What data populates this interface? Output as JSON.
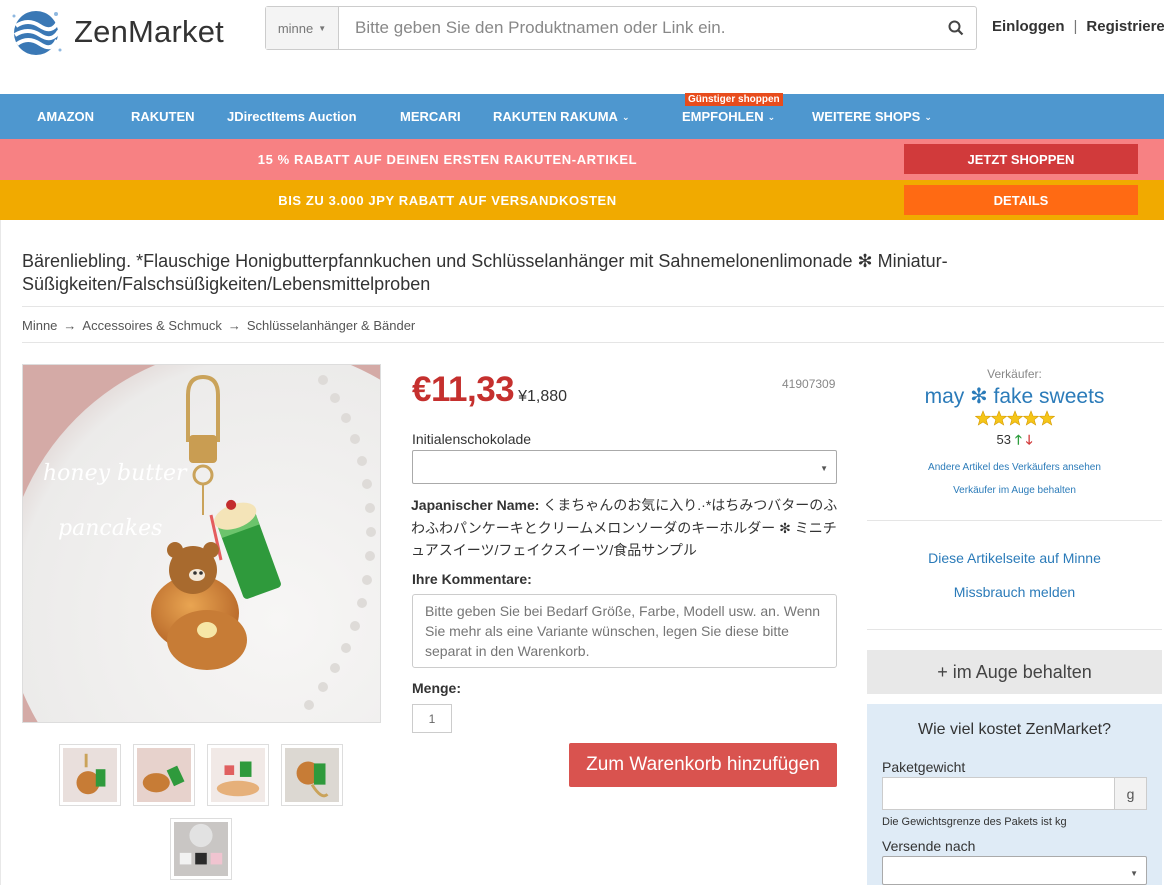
{
  "header": {
    "brand": "ZenMarket",
    "search_scope": "minne",
    "search_placeholder": "Bitte geben Sie den Produktnamen oder Link ein.",
    "login": "Einloggen",
    "register": "Registriere"
  },
  "nav": {
    "items": [
      "AMAZON",
      "RAKUTEN",
      "JDirectItems Auction",
      "MERCARI",
      "RAKUTEN RAKUMA",
      "EMPFOHLEN",
      "WEITERE SHOPS"
    ],
    "badge": "Günstiger shoppen"
  },
  "promos": [
    {
      "text": "15 % RABATT AUF DEINEN ERSTEN RAKUTEN-ARTIKEL",
      "button": "JETZT SHOPPEN"
    },
    {
      "text": "BIS ZU 3.000 JPY RABATT AUF VERSANDKOSTEN",
      "button": "DETAILS"
    }
  ],
  "product": {
    "title": "Bärenliebling. *Flauschige Honigbutterpfannkuchen und Schlüsselanhänger mit Sahnemelonenlimonade ✻ Miniatur-Süßigkeiten/Falschsüßigkeiten/Lebensmittelproben",
    "breadcrumb": [
      "Minne",
      "Accessoires & Schmuck",
      "Schlüsselanhänger & Bänder"
    ],
    "breadcrumb_arrow": "→",
    "photo_caption": [
      "honey butter",
      "pancakes"
    ],
    "price_eur": "€11,33",
    "price_jpy": "¥1,880",
    "item_id": "41907309",
    "option_label": "Initialenschokolade",
    "japanese_name_label": "Japanischer Name:",
    "japanese_name": " くまちゃんのお気に入り.·*はちみつバターのふわふわパンケーキとクリームメロンソーダのキーホルダー ✻ ミニチュアスイーツ/フェイクスイーツ/食品サンプル",
    "comments_label": "Ihre Kommentare:",
    "comments_placeholder": "Bitte geben Sie bei Bedarf Größe, Farbe, Modell usw. an. Wenn Sie mehr als eine Variante wünschen, legen Sie diese bitte separat in den Warenkorb.",
    "quantity_label": "Menge:",
    "quantity": "1",
    "add_to_cart": "Zum Warenkorb hinzufügen"
  },
  "seller": {
    "caption": "Verkäufer:",
    "name": "may ✻ fake sweets",
    "stars": 5,
    "rating_count": "53",
    "other_items": "Andere Artikel des Verkäufers ansehen",
    "watch_seller": "Verkäufer im Auge behalten"
  },
  "sidebar": {
    "item_page_link": "Diese Artikelseite auf Minne",
    "report_abuse": "Missbrauch melden",
    "watch_button": "+ im Auge behalten"
  },
  "cost_calculator": {
    "title": "Wie viel kostet ZenMarket?",
    "weight_label": "Paketgewicht",
    "weight_unit": "g",
    "weight_note": "Die Gewichtsgrenze des Pakets ist kg",
    "ship_to_label": "Versende nach"
  },
  "colors": {
    "nav_blue": "#4e97cf",
    "promo_pink": "#f78183",
    "promo_orange": "#f1aa00",
    "price_red": "#c5302e",
    "link_blue": "#2b7bb9"
  }
}
